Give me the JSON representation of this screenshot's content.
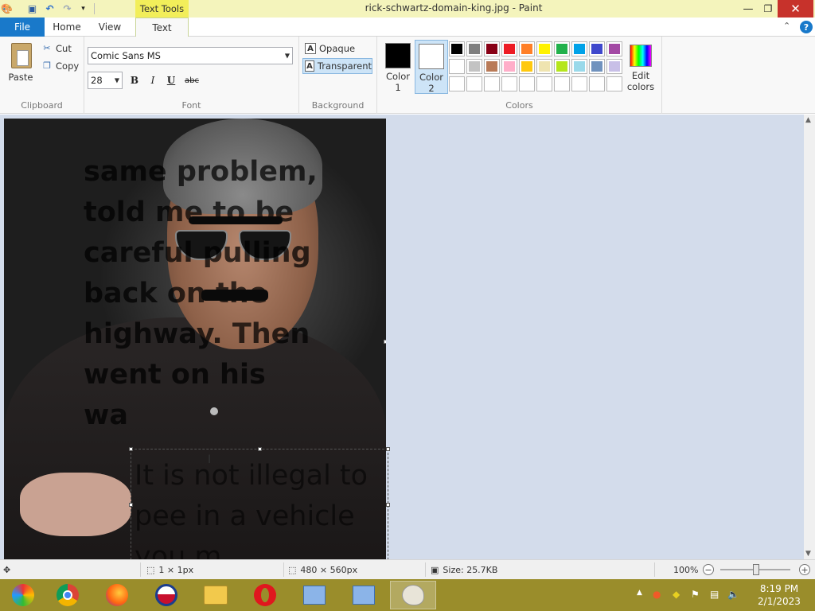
{
  "window": {
    "title": "rick-schwartz-domain-king.jpg - Paint",
    "context_tab": "Text Tools",
    "minimize": "—",
    "maximize": "❐",
    "close": "✕"
  },
  "tabs": {
    "file": "File",
    "home": "Home",
    "view": "View",
    "text": "Text",
    "help": "?"
  },
  "clipboard": {
    "paste": "Paste",
    "cut": "Cut",
    "copy": "Copy",
    "label": "Clipboard"
  },
  "font": {
    "family": "Comic Sans MS",
    "size": "28",
    "bold": "B",
    "italic": "I",
    "underline": "U",
    "strikethrough": "abc",
    "label": "Font"
  },
  "background": {
    "opaque": "Opaque",
    "transparent": "Transparent",
    "label": "Background"
  },
  "colors": {
    "color1_label": "Color\n1",
    "color1_line1": "Color",
    "color1_line2": "1",
    "color2_line1": "Color",
    "color2_line2": "2",
    "color1": "#000000",
    "color2": "#ffffff",
    "palette": [
      "#000000",
      "#7f7f7f",
      "#880015",
      "#ed1c24",
      "#ff7f27",
      "#fff200",
      "#22b14c",
      "#00a2e8",
      "#3f48cc",
      "#a349a4",
      "#ffffff",
      "#c3c3c3",
      "#b97a57",
      "#ffaec9",
      "#ffc90e",
      "#efe4b0",
      "#b5e61d",
      "#99d9ea",
      "#7092be",
      "#c8bfe7",
      "#ffffff",
      "#ffffff",
      "#ffffff",
      "#ffffff",
      "#ffffff",
      "#ffffff",
      "#ffffff",
      "#ffffff",
      "#ffffff",
      "#ffffff"
    ],
    "edit_line1": "Edit",
    "edit_line2": "colors",
    "label": "Colors"
  },
  "canvas": {
    "image_text_lines": [
      "same problem,",
      "told me to be",
      "careful pulling",
      "back on the",
      "highway. Then",
      "went on his",
      "wa"
    ],
    "textbox_lines": [
      "It is not illegal to",
      "pee in a vehicle",
      "you m"
    ]
  },
  "status": {
    "selection": "1 × 1px",
    "image_size": "480 × 560px",
    "file_size": "Size: 25.7KB",
    "zoom": "100%"
  },
  "taskbar": {
    "time": "8:19 PM",
    "date": "2/1/2023"
  }
}
